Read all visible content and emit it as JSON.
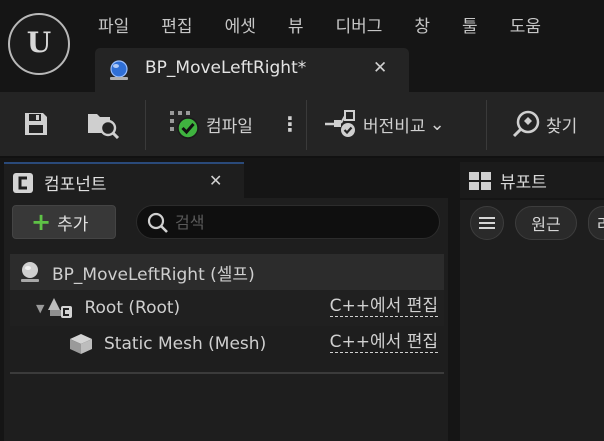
{
  "app": {
    "logo_letter": "U"
  },
  "menu": [
    "파일",
    "편집",
    "에셋",
    "뷰",
    "디버그",
    "창",
    "툴",
    "도움"
  ],
  "asset_tab": {
    "title": "BP_MoveLeftRight*",
    "close": "✕"
  },
  "toolbar": {
    "compile_label": "컴파일",
    "diff_label": "버전비교",
    "find_label": "찾기",
    "more": "⋮",
    "chevron": "⌄"
  },
  "components_panel": {
    "title": "컴포넌트",
    "close": "✕",
    "add_label": "추가",
    "add_plus": "+",
    "search_placeholder": "검색",
    "tree": [
      {
        "label": "BP_MoveLeftRight (셀프)"
      },
      {
        "label": "Root (Root)",
        "expander": "▼",
        "edit_label": "C++에서 편집"
      },
      {
        "label": "Static Mesh (Mesh)",
        "edit_label": "C++에서 편집"
      }
    ]
  },
  "viewport_panel": {
    "title": "뷰포트",
    "buttons": [
      "원근",
      "라"
    ]
  },
  "colors": {
    "accent_green": "#5ec246",
    "compile_ok": "#3fb33f",
    "panel_bg": "#1e1e1e",
    "selected_row": "#2c2c2c"
  }
}
